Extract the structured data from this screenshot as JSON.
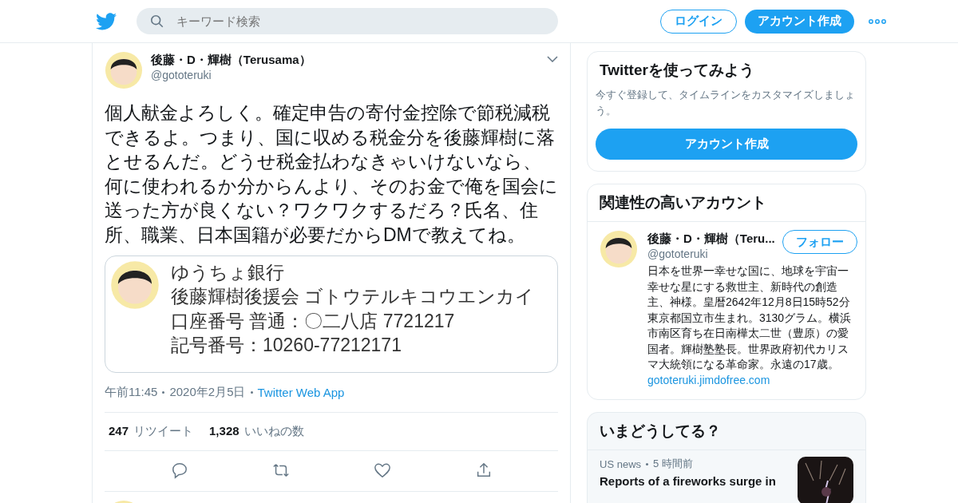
{
  "header": {
    "search": {
      "placeholder": "キーワード検索"
    },
    "login_button": "ログイン",
    "signup_button": "アカウント作成"
  },
  "tweet": {
    "name": "後藤・D・輝樹（Terusama）",
    "handle": "@gototeruki",
    "text": "個人献金よろしく。確定申告の寄付金控除で節税減税できるよ。つまり、国に収める税金分を後藤輝樹に落とせるんだ。どうせ税金払わなきゃいけないなら、何に使われるか分からんより、そのお金で俺を国会に送った方が良くない？ワクワクするだろ？氏名、住所、職業、日本国籍が必要だからDMで教えてね。",
    "attachment_lines": [
      "ゆうちょ銀行",
      "後藤輝樹後援会 ゴトウテルキコウエンカイ",
      "口座番号 普通：〇二八店 7721217",
      "記号番号：10260-77212171"
    ],
    "time": "午前11:45",
    "date": "2020年2月5日",
    "source": "Twitter Web App",
    "stats": [
      {
        "count": "247",
        "label": "リツイート"
      },
      {
        "count": "1,328",
        "label": "いいねの数"
      }
    ]
  },
  "signup_card": {
    "title": "Twitterを使ってみよう",
    "text": "今すぐ登録して、タイムラインをカスタマイズしましょう。",
    "button": "アカウント作成"
  },
  "related_card": {
    "title": "関連性の高いアカウント",
    "account": {
      "name": "後藤・D・輝樹（Teru...",
      "handle": "@gototeruki",
      "follow_button": "フォロー",
      "bio": "日本を世界一幸せな国に、地球を宇宙一幸せな星にする救世主、新時代の創造主、神様。皇暦2642年12月8日15時52分東京都国立市生まれ。3130グラム。横浜市南区育ち在日南樺太二世（豊原）の愛国者。輝樹塾塾長。世界政府初代カリスマ大統領になる革命家。永遠の17歳。",
      "link": "gototeruki.jimdofree.com"
    }
  },
  "trends_card": {
    "title": "いまどうしてる？",
    "item": {
      "source": "US news",
      "age": "5 時間前",
      "headline": "Reports of a fireworks surge in",
      "kind": "picture"
    }
  }
}
